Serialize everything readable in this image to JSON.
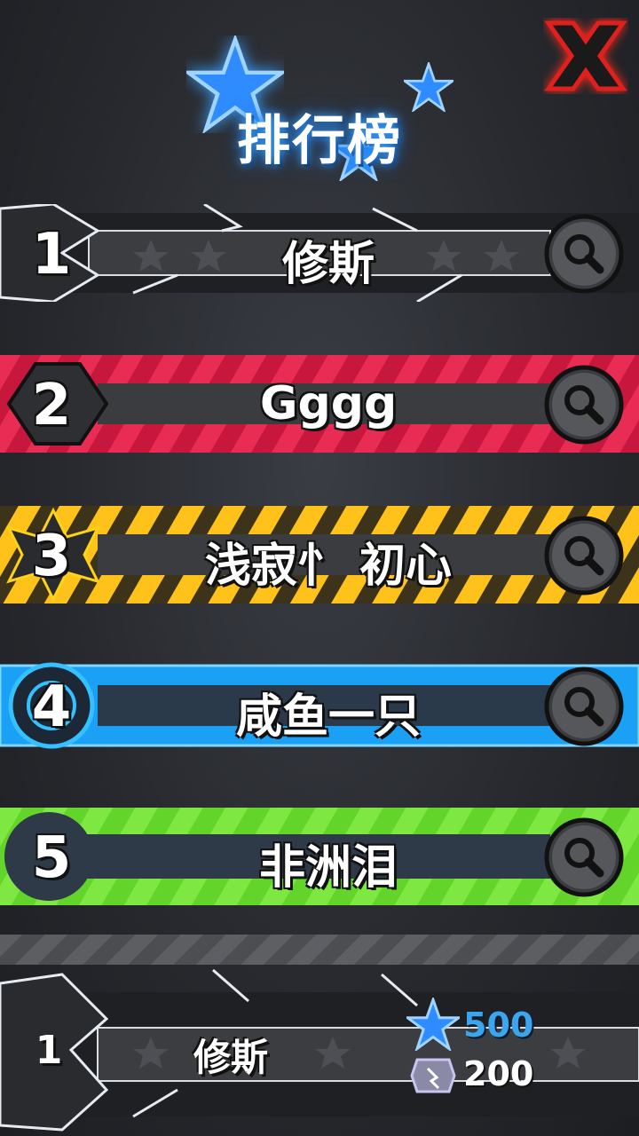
{
  "header": {
    "title": "排行榜",
    "close_icon": "close-x-icon",
    "accent_color": "#3aa0ff",
    "close_color": "#e0201e"
  },
  "leaderboard": [
    {
      "rank": "1",
      "name": "修斯",
      "theme": "silver",
      "icon": "search-icon"
    },
    {
      "rank": "2",
      "name": "Gggg",
      "theme": "red",
      "icon": "search-icon"
    },
    {
      "rank": "3",
      "name": "浅寂忄 初心",
      "theme": "yellow",
      "icon": "search-icon"
    },
    {
      "rank": "4",
      "name": "咸鱼一只",
      "theme": "blue",
      "icon": "search-icon"
    },
    {
      "rank": "5",
      "name": "非洲泪",
      "theme": "green",
      "icon": "search-icon"
    }
  ],
  "my_entry": {
    "rank": "1",
    "name": "修斯",
    "stars": "500",
    "gems": "200",
    "stars_icon": "star-icon",
    "gems_icon": "gem-icon"
  },
  "themes": {
    "silver": "#d8dde4",
    "red": "#e8204a",
    "yellow": "#ffcc16",
    "blue": "#1aa0f5",
    "green": "#6ee82e"
  }
}
